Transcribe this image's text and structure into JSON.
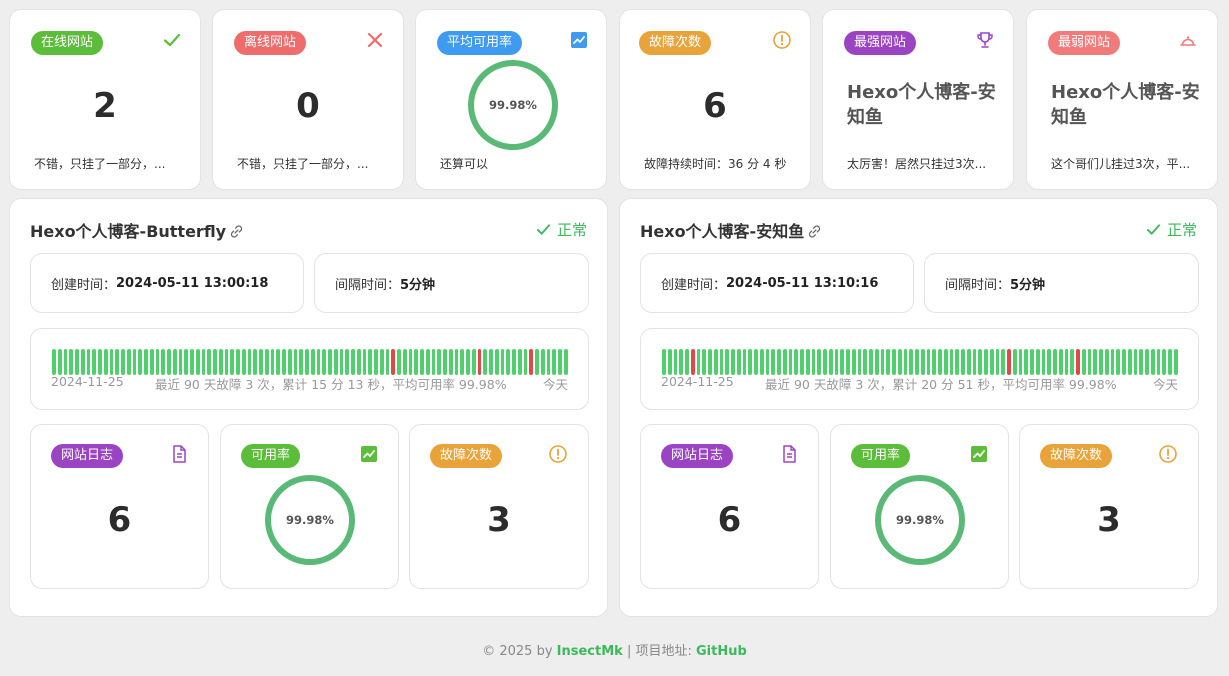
{
  "summary": {
    "online": {
      "badge": "在线网站",
      "value": "2",
      "note": "不错，只挂了一部分，..."
    },
    "offline": {
      "badge": "离线网站",
      "value": "0",
      "note": "不错，只挂了一部分，..."
    },
    "avg": {
      "badge": "平均可用率",
      "value": "99.98%",
      "note": "还算可以"
    },
    "faults": {
      "badge": "故障次数",
      "value": "6",
      "note": "故障持续时间：36 分 4 秒"
    },
    "best": {
      "badge": "最强网站",
      "name": "Hexo个人博客-安知鱼",
      "note": "太厉害！居然只挂过3次..."
    },
    "worst": {
      "badge": "最弱网站",
      "name": "Hexo个人博客-安知鱼",
      "note": "这个哥们儿挂过3次，平..."
    }
  },
  "colors": {
    "green": "#5cbd3b",
    "red": "#ee6c6c",
    "blue": "#3e9bf0",
    "orange": "#e8a33a",
    "purple": "#9b44c3",
    "pink": "#f07b7b",
    "bar_up": "#4fd06d",
    "bar_down": "#e14848",
    "status": "#3cb95d"
  },
  "sites": [
    {
      "title": "Hexo个人博客-Butterfly",
      "status": "正常",
      "created_label": "创建时间：",
      "created_value": "2024-05-11 13:00:18",
      "interval_label": "间隔时间：",
      "interval_value": "5分钟",
      "start_date": "2024-11-25",
      "summary": "最近 90 天故障 3 次，累计 15 分 13 秒，平均可用率 99.98%",
      "end_label": "今天",
      "down_days": [
        59,
        83,
        74
      ],
      "log_badge": "网站日志",
      "log_value": "6",
      "avail_badge": "可用率",
      "avail_value": "99.98%",
      "fault_badge": "故障次数",
      "fault_value": "3"
    },
    {
      "title": "Hexo个人博客-安知鱼",
      "status": "正常",
      "created_label": "创建时间：",
      "created_value": "2024-05-11 13:10:16",
      "interval_label": "间隔时间：",
      "interval_value": "5分钟",
      "start_date": "2024-11-25",
      "summary": "最近 90 天故障 3 次，累计 20 分 51 秒，平均可用率 99.98%",
      "end_label": "今天",
      "down_days": [
        5,
        60,
        72
      ],
      "log_badge": "网站日志",
      "log_value": "6",
      "avail_badge": "可用率",
      "avail_value": "99.98%",
      "fault_badge": "故障次数",
      "fault_value": "3"
    }
  ],
  "footer": {
    "copyright": "© 2025 by",
    "author": "InsectMk",
    "sep": " | 项目地址: ",
    "repo": "GitHub"
  }
}
